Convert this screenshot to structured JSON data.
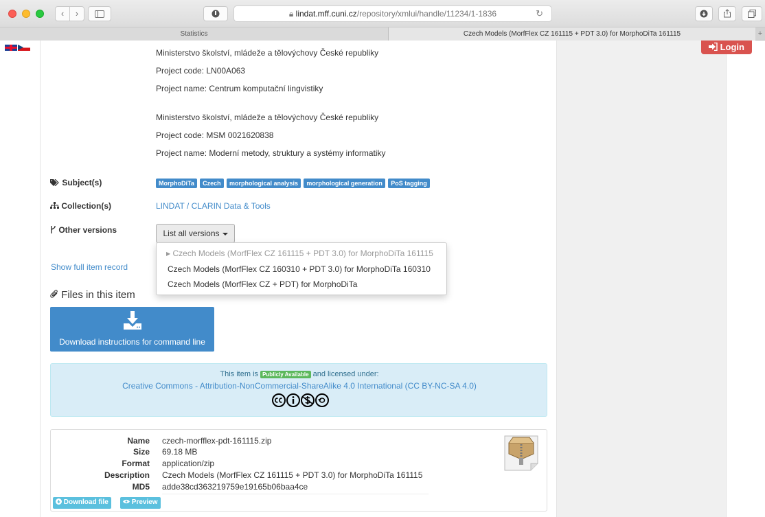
{
  "browser": {
    "url_host": "lindat.mff.cuni.cz",
    "url_path": "/repository/xmlui/handle/11234/1-1836",
    "tabs": [
      {
        "label": "Statistics"
      },
      {
        "label": "Czech Models (MorfFlex CZ 161115 + PDT 3.0) for MorphoDiTa 161115"
      }
    ],
    "new_tab_label": "+"
  },
  "header": {
    "login_label": "Login"
  },
  "funding": [
    {
      "ministry": "Ministerstvo školství, mládeže a tělovýchovy České republiky",
      "code": "Project code: LN00A063",
      "name": "Project name: Centrum komputační lingvistiky"
    },
    {
      "ministry": "Ministerstvo školství, mládeže a tělovýchovy České republiky",
      "code": "Project code: MSM 0021620838",
      "name": "Project name: Moderní metody, struktury a systémy informatiky"
    }
  ],
  "subjects": {
    "label": "Subject(s)",
    "tags": [
      "MorphoDiTa",
      "Czech",
      "morphological analysis",
      "morphological generation",
      "PoS tagging"
    ]
  },
  "collection": {
    "label": "Collection(s)",
    "value": "LINDAT / CLARIN Data & Tools"
  },
  "versions": {
    "label": "Other versions",
    "button_label": "List all versions",
    "items": [
      "Czech Models (MorfFlex CZ 161115 + PDT 3.0) for MorphoDiTa 161115",
      "Czech Models (MorfFlex CZ 160310 + PDT 3.0) for MorphoDiTa 160310",
      "Czech Models (MorfFlex CZ + PDT) for MorphoDiTa"
    ]
  },
  "show_full_record": "Show full item record",
  "files": {
    "heading": "Files in this item",
    "download_instructions": "Download instructions for command line"
  },
  "license": {
    "prefix": "This item is",
    "badge": "Publicly Available",
    "suffix": "and licensed under:",
    "name": "Creative Commons - Attribution-NonCommercial-ShareAlike 4.0 International (CC BY-NC-SA 4.0)"
  },
  "file": {
    "name_label": "Name",
    "name": "czech-morfflex-pdt-161115.zip",
    "size_label": "Size",
    "size": "69.18 MB",
    "format_label": "Format",
    "format": "application/zip",
    "description_label": "Description",
    "description": "Czech Models (MorfFlex CZ 161115 + PDT 3.0) for MorphoDiTa 161115",
    "md5_label": "MD5",
    "md5": "adde38cd363219759e19165b06baa4ce",
    "download_label": "Download file",
    "preview_label": "Preview"
  },
  "colors": {
    "link": "#428bca",
    "login": "#d9534f",
    "badge": "#5cb85c",
    "info_bg": "#d9edf7",
    "small_button": "#5bc0de"
  }
}
